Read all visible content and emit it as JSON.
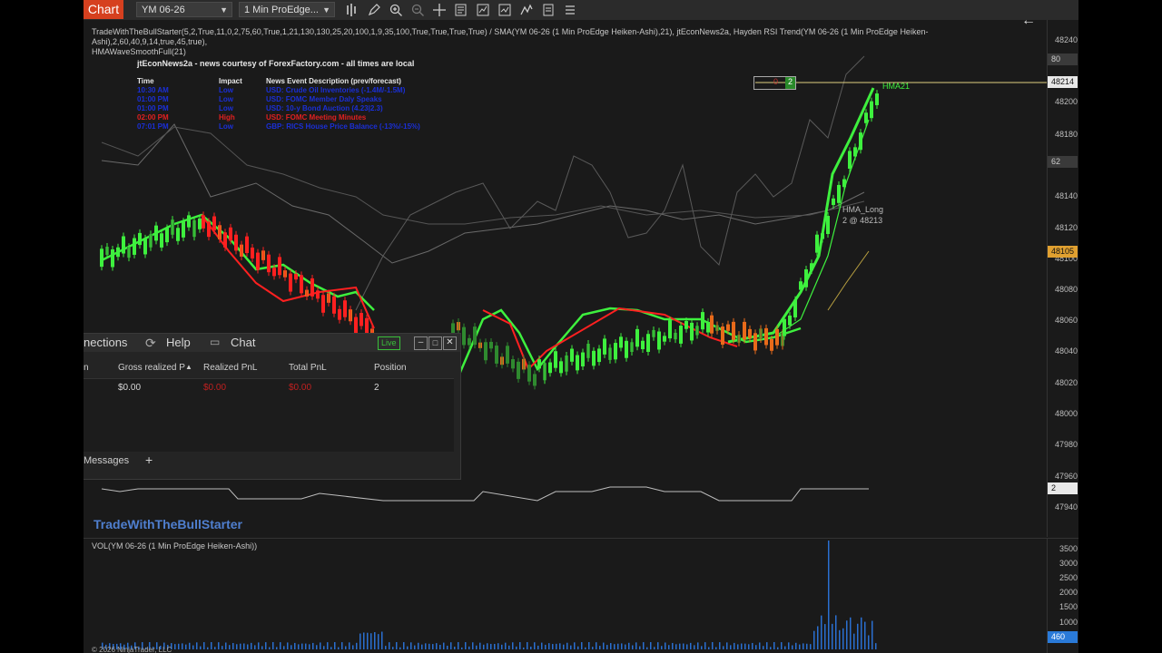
{
  "toolbar": {
    "chart_tab": "Chart",
    "instrument": "YM 06-26",
    "interval": "1 Min ProEdge...",
    "icons": [
      "bar-type-icon",
      "draw-pencil-icon",
      "zoom-in-icon",
      "zoom-out-icon",
      "crosshair-icon",
      "data-box-icon",
      "strategy-icon",
      "indicator-icon",
      "chart-trader-icon",
      "properties-icon",
      "menu-icon"
    ]
  },
  "chart": {
    "indicators_line1": "TradeWithTheBullStarter(5,2,True,11,0,2,75,60,True,1,21,130,130,25,20,100,1,9,35,100,True,True,True,True) / SMA(YM 06-26 (1 Min ProEdge Heiken-Ashi),21), jtEconNews2a, Hayden RSI Trend(YM 06-26 (1 Min ProEdge Heiken-Ashi),2,60,40,9,14,true,45,true),",
    "indicators_line2": "HMAWaveSmoothFull(21)",
    "watermark": "TradeWithTheBullStarter",
    "hma_label": "HMA21",
    "trade_label_1": "HMA_Long",
    "trade_label_2": "2 @ 48213",
    "position_box_left": "0",
    "position_box_right": "2",
    "copyright": "© 2026 NinjaTrader, LLC"
  },
  "news": {
    "title": "jtEconNews2a - news courtesy of ForexFactory.com - all times are local",
    "headers": {
      "time": "Time",
      "impact": "Impact",
      "desc": "News Event Description (prev/forecast)"
    },
    "rows": [
      {
        "time": "10:30 AM",
        "impact": "Low",
        "desc": "USD: Crude Oil Inventories (-1.4M/-1.5M)",
        "color": "#1a2fd6"
      },
      {
        "time": "01:00 PM",
        "impact": "Low",
        "desc": "USD: FOMC Member Daly Speaks",
        "color": "#1a2fd6"
      },
      {
        "time": "01:00 PM",
        "impact": "Low",
        "desc": "USD: 10-y Bond Auction (4.23|2.3)",
        "color": "#1a2fd6"
      },
      {
        "time": "02:00 PM",
        "impact": "High",
        "desc": "USD: FOMC Meeting Minutes",
        "color": "#e02020"
      },
      {
        "time": "07:01 PM",
        "impact": "Low",
        "desc": "GBP: RICS House Price Balance (-13%/-15%)",
        "color": "#1a2fd6"
      }
    ]
  },
  "axis_main": {
    "ticks": [
      "48240",
      "48200",
      "48180",
      "48140",
      "48120",
      "48100",
      "48080",
      "48060",
      "48040",
      "48020",
      "48000",
      "47980",
      "47960",
      "47940"
    ],
    "tags": [
      {
        "label": "80",
        "bg": "#3a3a3a",
        "fg": "#ccc"
      },
      {
        "label": "48214",
        "bg": "#e8e8e8",
        "fg": "#111"
      },
      {
        "label": "62",
        "bg": "#3a3a3a",
        "fg": "#ccc"
      },
      {
        "label": "48105",
        "bg": "#e0a030",
        "fg": "#111"
      },
      {
        "label": "2",
        "bg": "#e8e8e8",
        "fg": "#111"
      }
    ]
  },
  "volume": {
    "label": "VOL(YM 06-26 (1 Min ProEdge Heiken-Ashi))",
    "ticks": [
      "3500",
      "3000",
      "2500",
      "2000",
      "1500",
      "1000"
    ],
    "current_tag": "460"
  },
  "control_center": {
    "menu": {
      "connections": "nections",
      "help": "Help",
      "chat": "Chat",
      "live": "Live"
    },
    "columns": [
      "n",
      "Gross realized P",
      "Realized PnL",
      "Total PnL",
      "Position"
    ],
    "row": {
      "gross": "$0.00",
      "realized": "$0.00",
      "total": "$0.00",
      "position": "2"
    },
    "footer_tab": "Messages",
    "add": "+"
  },
  "colors": {
    "accent": "#d6401f",
    "bull": "#3ef03e",
    "bear": "#ff2020",
    "neutral_candle": "#2f8a2f",
    "orange": "#e86a1a",
    "news_high": "#e02020",
    "news_low": "#1a2fd6",
    "volume": "#2a6fd0"
  }
}
